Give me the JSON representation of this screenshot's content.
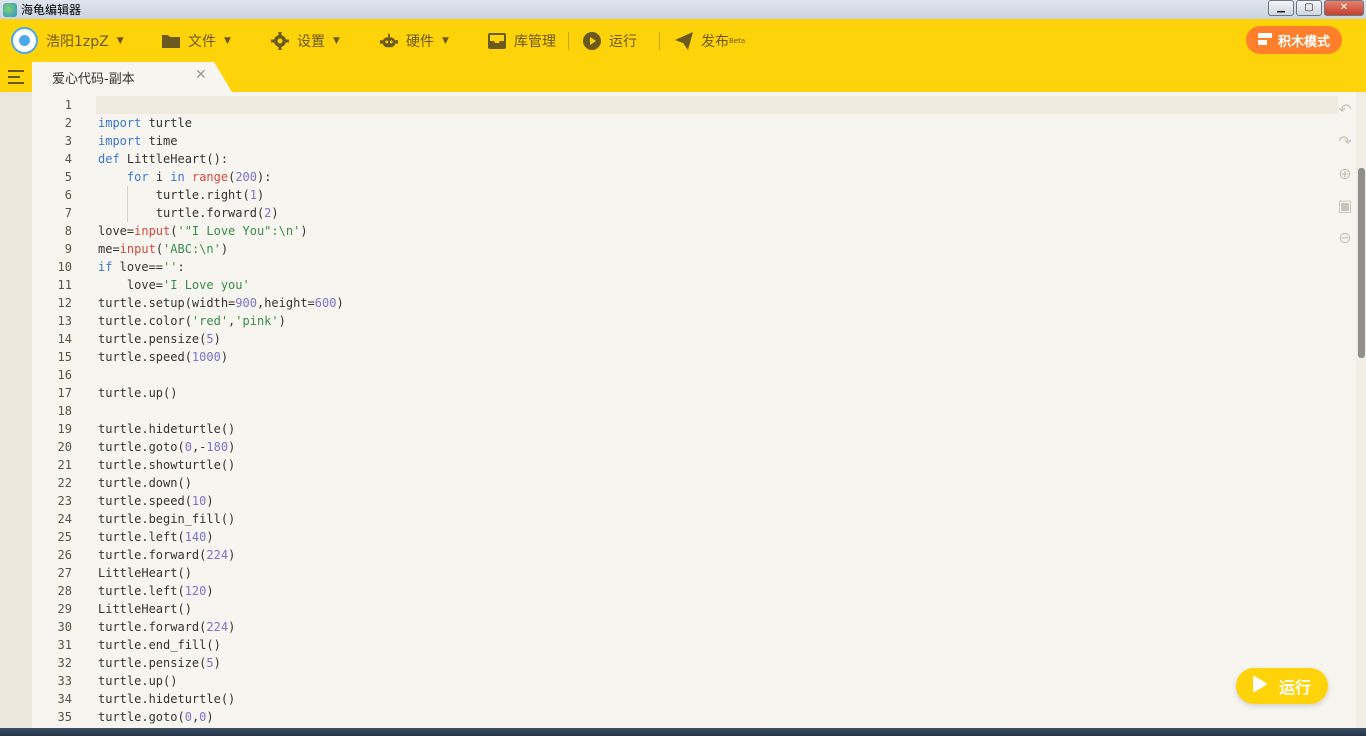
{
  "window": {
    "title": "海龟编辑器",
    "controls": {
      "minimize": "▁",
      "maximize": "▢",
      "close": "✕"
    }
  },
  "toolbar": {
    "user": {
      "name": "浩阳1zpZ"
    },
    "menus": [
      {
        "label": "文件",
        "icon": "folder-icon"
      },
      {
        "label": "设置",
        "icon": "gear-icon"
      },
      {
        "label": "硬件",
        "icon": "robot-icon"
      },
      {
        "label": "库管理",
        "icon": "inbox-icon"
      },
      {
        "label": "运行",
        "icon": "play-icon"
      },
      {
        "label": "发布",
        "icon": "paper-plane-icon",
        "badge": "Beta"
      }
    ],
    "block_mode_label": "积木模式"
  },
  "tabs": [
    {
      "label": "爱心代码-副本",
      "close": "✕"
    }
  ],
  "editor": {
    "lines": [
      "",
      "import turtle",
      "import time",
      "def LittleHeart():",
      "    for i in range(200):",
      "        turtle.right(1)",
      "        turtle.forward(2)",
      "love=input('\"I Love You\":\\n')",
      "me=input('ABC:\\n')",
      "if love=='':",
      "    love='I Love you'",
      "turtle.setup(width=900,height=600)",
      "turtle.color('red','pink')",
      "turtle.pensize(5)",
      "turtle.speed(1000)",
      "",
      "turtle.up()",
      "",
      "turtle.hideturtle()",
      "turtle.goto(0,-180)",
      "turtle.showturtle()",
      "turtle.down()",
      "turtle.speed(10)",
      "turtle.begin_fill()",
      "turtle.left(140)",
      "turtle.forward(224)",
      "LittleHeart()",
      "turtle.left(120)",
      "LittleHeart()",
      "turtle.forward(224)",
      "turtle.end_fill()",
      "turtle.pensize(5)",
      "turtle.up()",
      "turtle.hideturtle()",
      "turtle.goto(0,0)"
    ]
  },
  "run_button_label": "运行",
  "colors": {
    "toolbar": "#ffd30a",
    "accent_orange": "#ff7f2a",
    "keyword": "#3c76d1",
    "builtin": "#d4493b",
    "string": "#3a8a4a",
    "number": "#7a72c9"
  }
}
